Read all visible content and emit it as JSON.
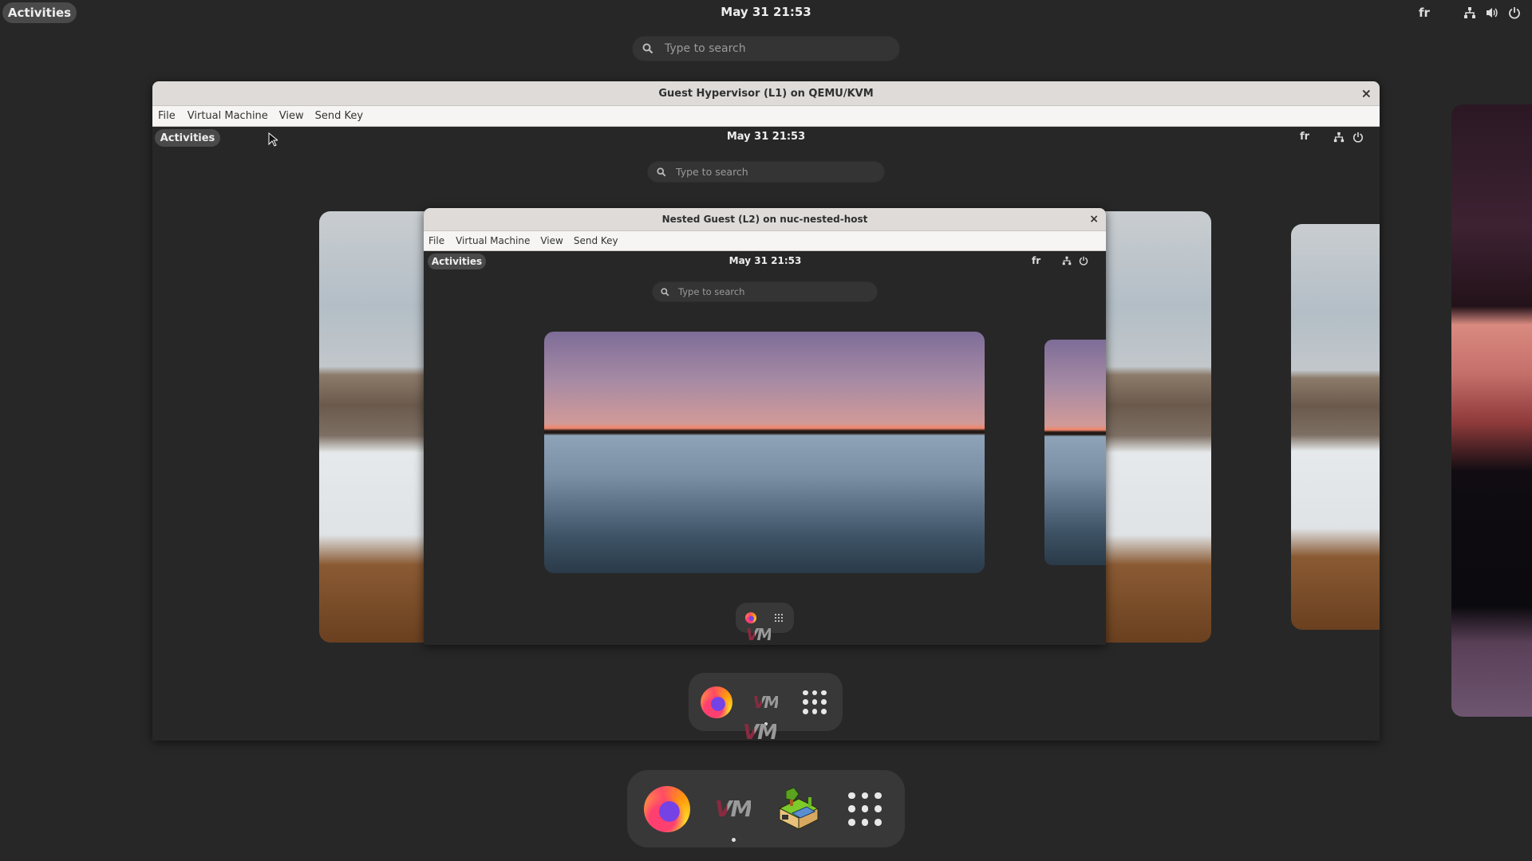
{
  "host": {
    "topbar": {
      "activities_label": "Activities",
      "clock": "May 31  21:53",
      "keyboard_layout": "fr",
      "tray_icons": [
        "network-icon",
        "volume-icon",
        "power-icon"
      ]
    },
    "search": {
      "placeholder": "Type to search",
      "icon": "search-icon"
    },
    "dock": {
      "items": [
        {
          "name": "Firefox",
          "icon": "firefox-icon",
          "running": false
        },
        {
          "name": "Virtual Machine Manager",
          "icon": "virt-manager-icon",
          "running": true
        },
        {
          "name": "Minetest",
          "icon": "minetest-icon",
          "running": false
        },
        {
          "name": "Show Applications",
          "icon": "app-grid-icon",
          "running": false
        }
      ]
    },
    "workspace_right_wallpaper": "canyon"
  },
  "l1_window": {
    "title": "Guest Hypervisor (L1) on QEMU/KVM",
    "close_label": "×",
    "menu": [
      "File",
      "Virtual Machine",
      "View",
      "Send Key"
    ],
    "topbar": {
      "activities_label": "Activities",
      "clock": "May 31  21:53",
      "keyboard_layout": "fr",
      "tray_icons": [
        "network-icon",
        "power-icon"
      ]
    },
    "search": {
      "placeholder": "Type to search"
    },
    "dock": {
      "items": [
        {
          "name": "Firefox",
          "icon": "firefox-icon"
        },
        {
          "name": "Virtual Machine Manager",
          "icon": "virt-manager-icon",
          "running": true
        },
        {
          "name": "Show Applications",
          "icon": "app-grid-icon"
        }
      ],
      "drag_label_icon": "virt-manager-icon"
    }
  },
  "l2_window": {
    "title": "Nested Guest (L2) on nuc-nested-host",
    "close_label": "×",
    "menu": [
      "File",
      "Virtual Machine",
      "View",
      "Send Key"
    ],
    "topbar": {
      "activities_label": "Activities",
      "clock": "May 31  21:53",
      "keyboard_layout": "fr",
      "tray_icons": [
        "network-icon",
        "power-icon"
      ]
    },
    "search": {
      "placeholder": "Type to search"
    },
    "dock": {
      "items": [
        {
          "name": "Firefox",
          "icon": "firefox-icon"
        },
        {
          "name": "Show Applications",
          "icon": "app-grid-icon"
        }
      ],
      "drag_label_icon": "virt-manager-icon"
    }
  },
  "vmm_glyph": "VM"
}
